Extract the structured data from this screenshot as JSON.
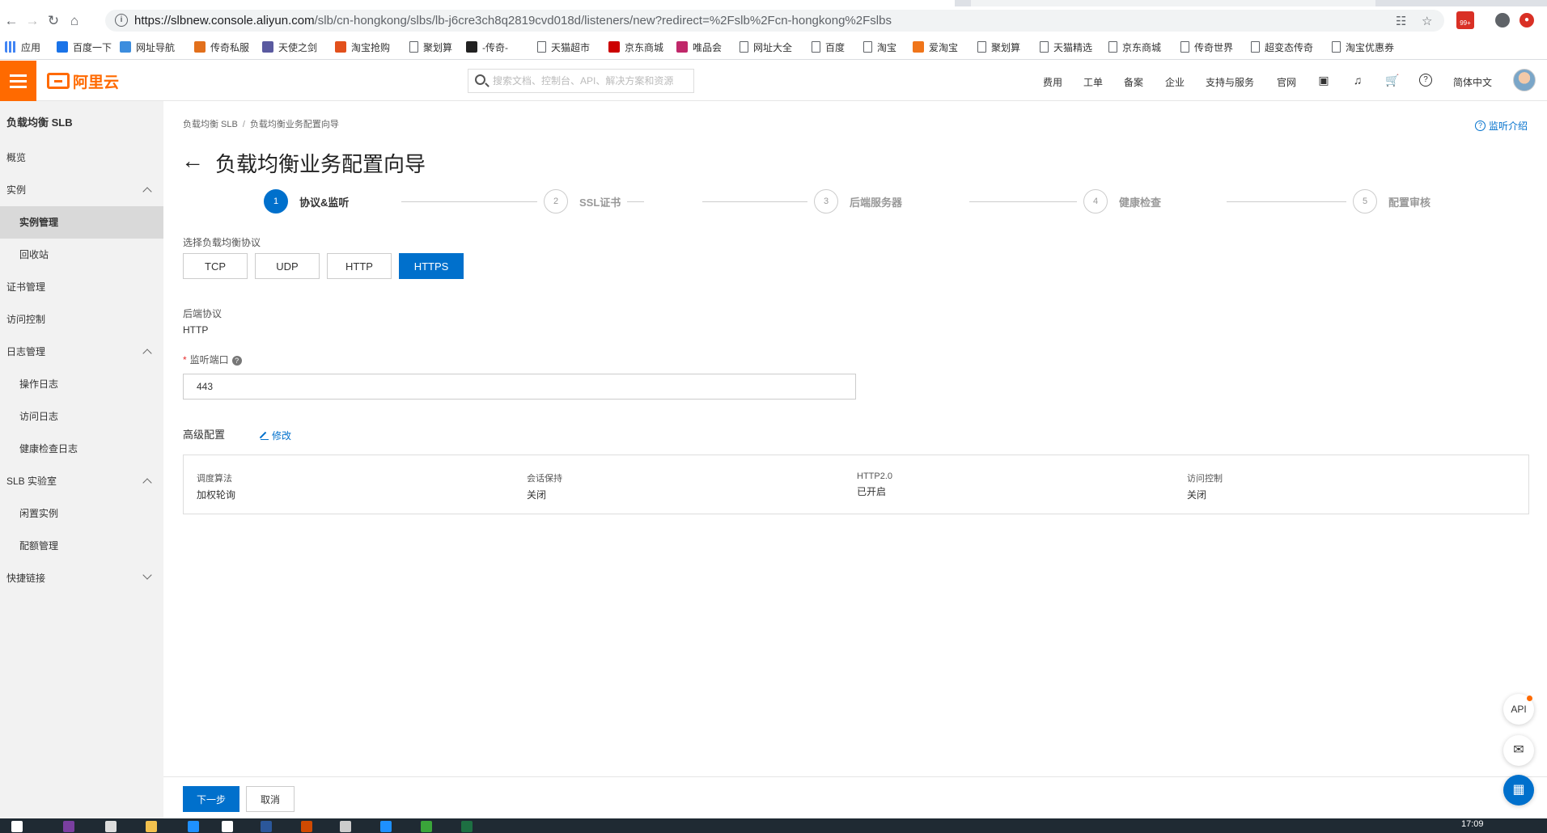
{
  "browser": {
    "url_host": "https://slbnew.console.aliyun.com",
    "url_path": "/slb/cn-hongkong/slbs/lb-j6cre3ch8q2819cvd018d/listeners/new?redirect=%2Fslb%2Fcn-hongkong%2Fslbs",
    "badge": "99+",
    "bookmarks": [
      "应用",
      "百度一下",
      "网址导航",
      "传奇私服",
      "天使之剑",
      "淘宝抢购",
      "聚划算",
      "-传奇-",
      "天猫超市",
      "京东商城",
      "唯品会",
      "网址大全",
      "百度",
      "淘宝",
      "爱淘宝",
      "聚划算",
      "天猫精选",
      "京东商城",
      "传奇世界",
      "超变态传奇",
      "淘宝优惠券"
    ]
  },
  "header": {
    "logo": "阿里云",
    "search_placeholder": "搜索文档、控制台、API、解决方案和资源",
    "nav": [
      "费用",
      "工单",
      "备案",
      "企业",
      "支持与服务",
      "官网"
    ],
    "language": "简体中文"
  },
  "sidebar": {
    "title": "负载均衡 SLB",
    "items": [
      "概览",
      "实例",
      "实例管理",
      "回收站",
      "证书管理",
      "访问控制",
      "日志管理",
      "操作日志",
      "访问日志",
      "健康检查日志",
      "SLB 实验室",
      "闲置实例",
      "配额管理",
      "快捷链接"
    ]
  },
  "main": {
    "breadcrumb": [
      "负载均衡 SLB",
      "负载均衡业务配置向导"
    ],
    "help_link": "监听介绍",
    "title": "负载均衡业务配置向导",
    "steps": [
      {
        "num": "1",
        "label": "协议&监听"
      },
      {
        "num": "2",
        "label": "SSL证书"
      },
      {
        "num": "3",
        "label": "后端服务器"
      },
      {
        "num": "4",
        "label": "健康检查"
      },
      {
        "num": "5",
        "label": "配置审核"
      }
    ],
    "protocol_label": "选择负载均衡协议",
    "protocols": [
      "TCP",
      "UDP",
      "HTTP",
      "HTTPS"
    ],
    "selected_protocol": "HTTPS",
    "backend_protocol_label": "后端协议",
    "backend_protocol_value": "HTTP",
    "port_label": "监听端口",
    "port_required_mark": "*",
    "port_value": "443",
    "advanced_title": "高级配置",
    "advanced_edit": "修改",
    "advanced": [
      {
        "key": "调度算法",
        "value": "加权轮询"
      },
      {
        "key": "会话保持",
        "value": "关闭"
      },
      {
        "key": "HTTP2.0",
        "value": "已开启"
      },
      {
        "key": "访问控制",
        "value": "关闭"
      }
    ]
  },
  "footer": {
    "next": "下一步",
    "cancel": "取消"
  },
  "float": {
    "api": "API"
  },
  "taskbar": {
    "clock": "17:09"
  }
}
